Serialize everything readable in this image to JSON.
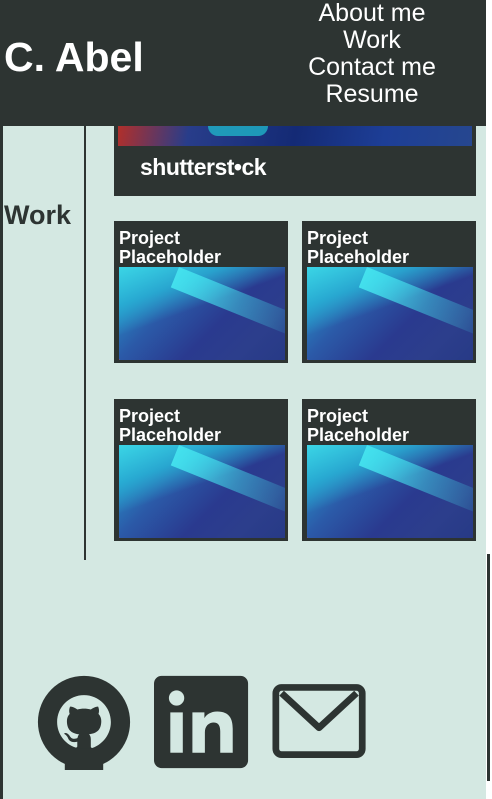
{
  "header": {
    "brand": "C. Abel",
    "nav": [
      "About me",
      "Work",
      "Contact me",
      "Resume"
    ]
  },
  "hero": {
    "watermark": "shutterst•ck"
  },
  "work": {
    "label": "Work",
    "projects": [
      {
        "title": "Project Placeholder"
      },
      {
        "title": "Project Placeholder"
      },
      {
        "title": "Project Placeholder"
      },
      {
        "title": "Project Placeholder"
      }
    ]
  },
  "social": {
    "icons": [
      "github-icon",
      "linkedin-icon",
      "mail-icon"
    ]
  },
  "colors": {
    "dark": "#2d3432",
    "background": "#d4e8e2",
    "text_light": "#ffffff"
  }
}
